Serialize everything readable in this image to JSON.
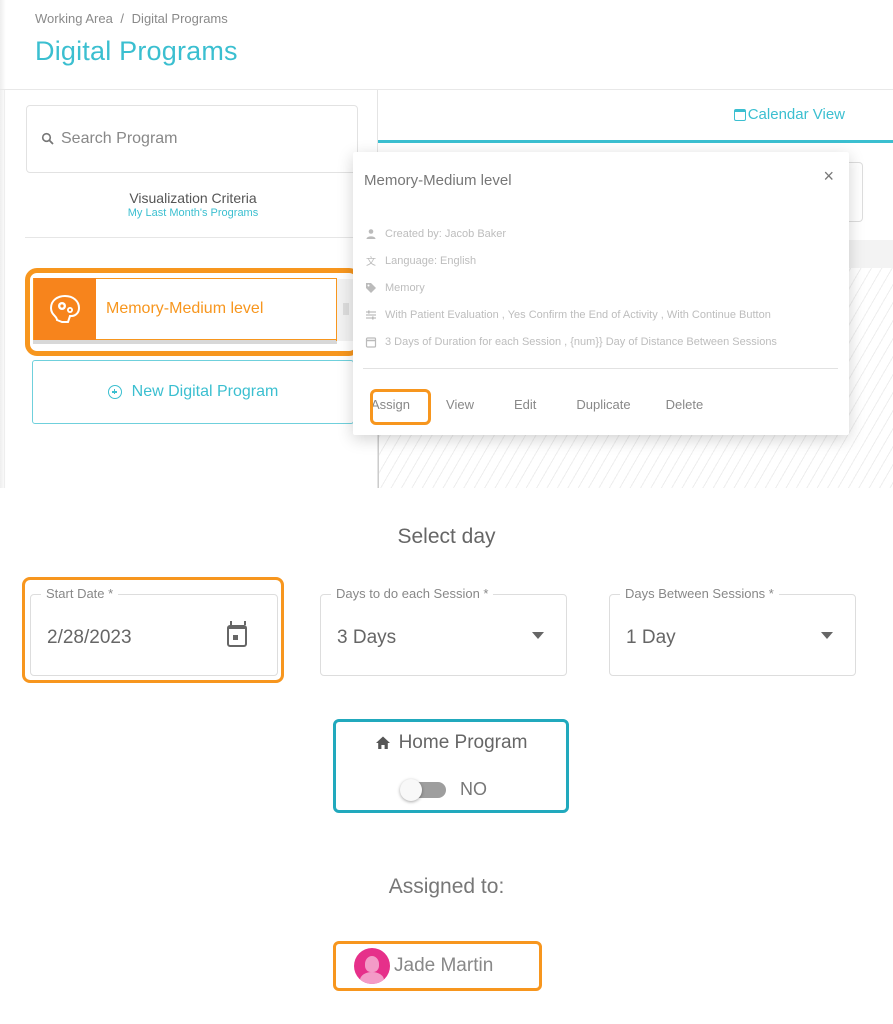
{
  "breadcrumb": [
    "Working Area",
    "/",
    "Digital Programs"
  ],
  "page_title": "Digital Programs",
  "sidebar": {
    "search_placeholder": "Search Program",
    "visualization_label": "Visualization Criteria",
    "visualization_value": "My Last Month's Programs",
    "programs": [
      {
        "name": "Memory-Medium level",
        "icon": "brain-gears-icon",
        "color": "#f7841c"
      }
    ],
    "new_program_label": "New Digital Program"
  },
  "main": {
    "tab_label": "Calendar View"
  },
  "popup": {
    "title": "Memory-Medium level",
    "close": "×",
    "details": [
      {
        "icon": "user-icon",
        "text": "Created by: Jacob Baker"
      },
      {
        "icon": "language-icon",
        "text": "Language: English"
      },
      {
        "icon": "tag-icon",
        "text": "Memory"
      },
      {
        "icon": "settings-sliders-icon",
        "text": "With Patient Evaluation , Yes Confirm the End of Activity , With Continue Button"
      },
      {
        "icon": "calendar-icon",
        "text": "3 Days of Duration for each Session , {num}} Day of Distance Between Sessions"
      }
    ],
    "actions": [
      "Assign",
      "View",
      "Edit",
      "Duplicate",
      "Delete"
    ]
  },
  "assign_form": {
    "section_title": "Select day",
    "start_date": {
      "label": "Start Date *",
      "value": "2/28/2023"
    },
    "days_each_session": {
      "label": "Days to do each Session *",
      "value": "3 Days"
    },
    "days_between": {
      "label": "Days Between Sessions *",
      "value": "1 Day"
    },
    "home_program": {
      "label": "Home Program",
      "toggle_on": false,
      "toggle_text": "NO"
    },
    "assigned_title": "Assigned to:",
    "assignee": "Jade Martin"
  },
  "colors": {
    "accent": "#3bbfd0",
    "highlight": "#f7961e",
    "home_box": "#21a9bd",
    "avatar": "#e6308a"
  }
}
